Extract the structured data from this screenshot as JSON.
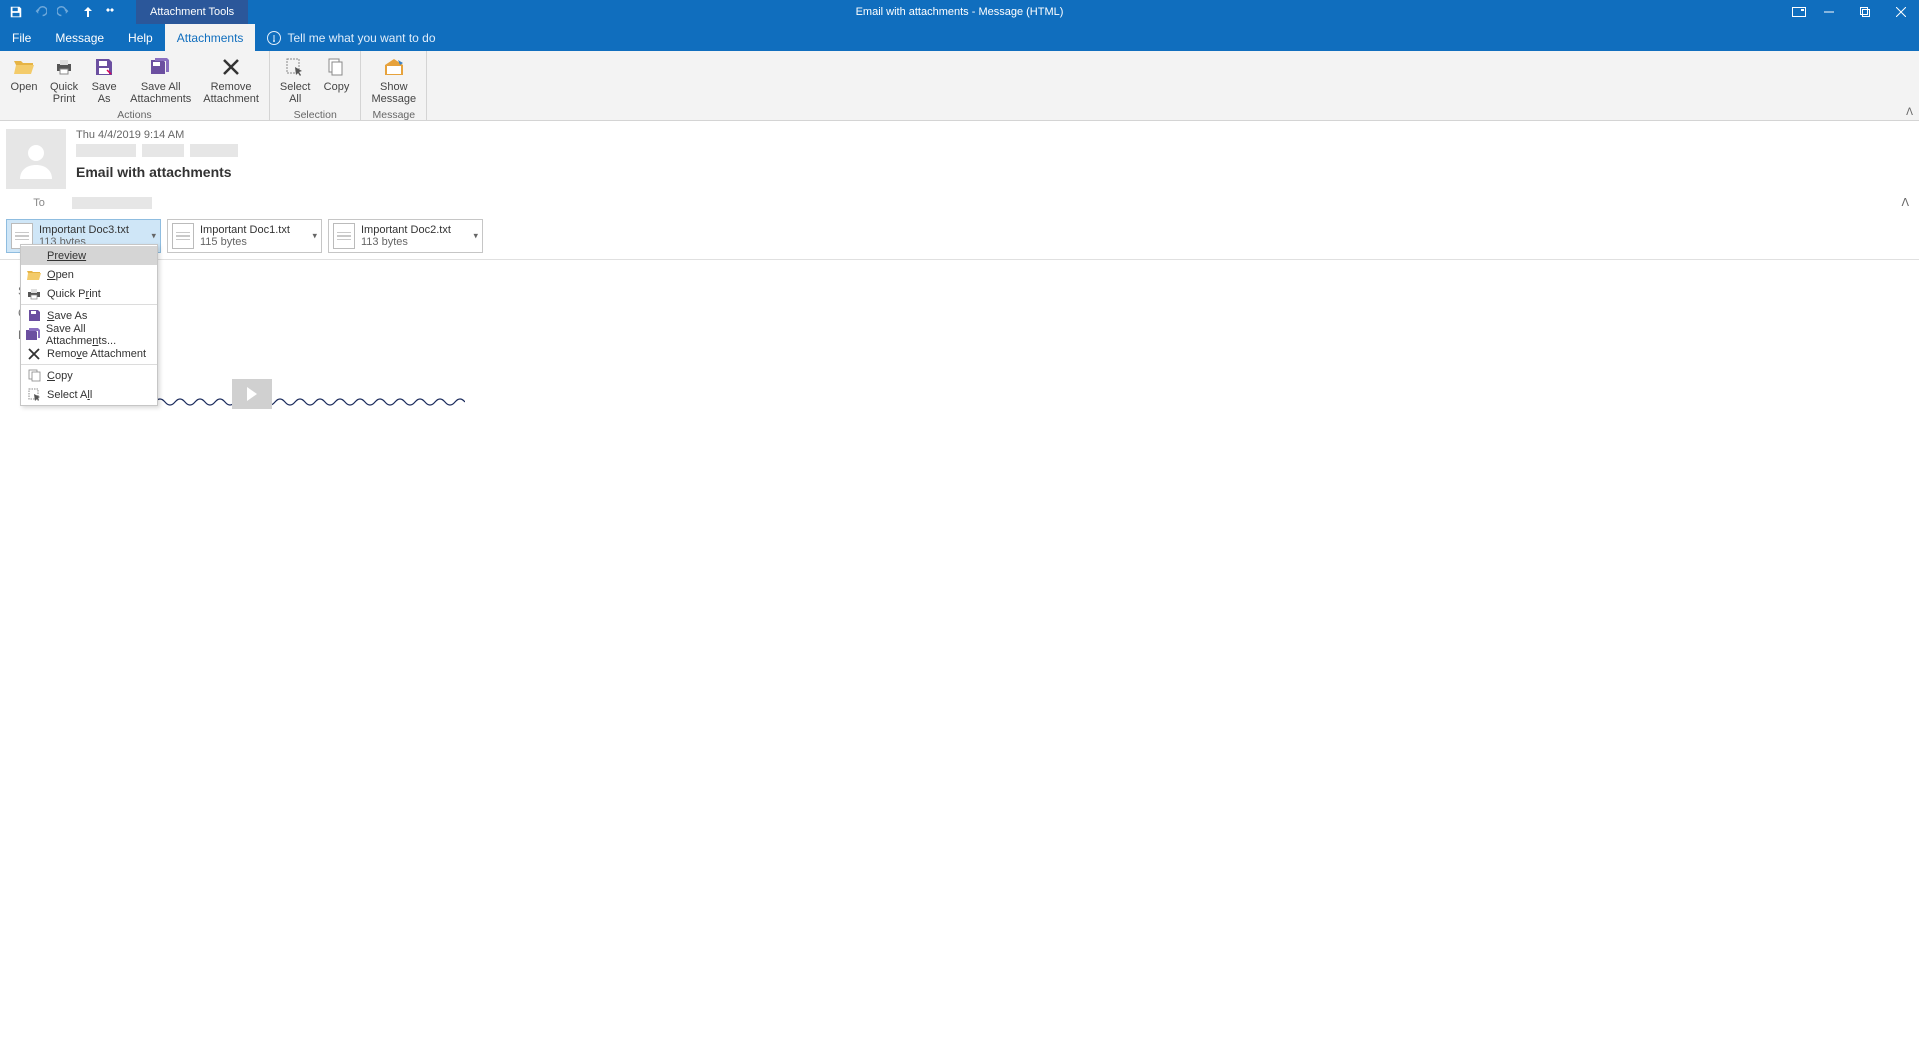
{
  "titlebar": {
    "contextual_tab": "Attachment Tools",
    "title": "Email with attachments  -  Message (HTML)"
  },
  "menu": {
    "file": "File",
    "message": "Message",
    "help": "Help",
    "attachments": "Attachments",
    "tell_me": "Tell me what you want to do"
  },
  "ribbon": {
    "open": "Open",
    "quick_print": "Quick\nPrint",
    "save_as": "Save\nAs",
    "save_all": "Save All\nAttachments",
    "remove": "Remove\nAttachment",
    "select_all": "Select\nAll",
    "copy": "Copy",
    "show_message": "Show\nMessage",
    "group_actions": "Actions",
    "group_selection": "Selection",
    "group_message": "Message"
  },
  "header": {
    "date": "Thu 4/4/2019 9:14 AM",
    "subject": "Email with attachments",
    "to_label": "To"
  },
  "attachments": [
    {
      "name": "Important Doc3.txt",
      "size": "113 bytes",
      "selected": true
    },
    {
      "name": "Important Doc1.txt",
      "size": "115 bytes",
      "selected": false
    },
    {
      "name": "Important Doc2.txt",
      "size": "113 bytes",
      "selected": false
    }
  ],
  "body_frag": {
    "l0": "Se",
    "l1": "Cl",
    "l2": "Li"
  },
  "ctx": {
    "preview": "Preview",
    "open": "Open",
    "quick_print": "Quick Print",
    "save_as": "Save As",
    "save_all": "Save All Attachments...",
    "remove": "Remove Attachment",
    "copy": "Copy",
    "select_all": "Select All"
  }
}
